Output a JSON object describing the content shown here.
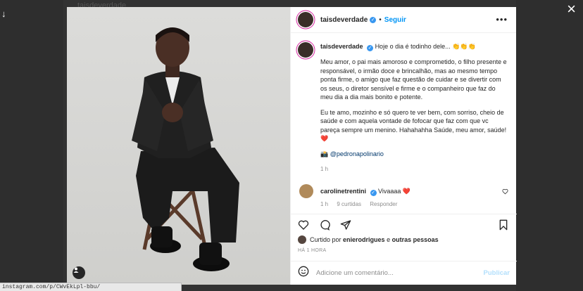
{
  "browser": {
    "ghost_title": "taisdeverdade",
    "status_url": "instagram.com/p/CWvEkLpl-bbu/"
  },
  "post": {
    "username": "taisdeverdade",
    "follow_label": "Seguir",
    "more_label": "•••",
    "caption_intro": "Hoje o dia é todinho dele... 👏👏👏",
    "caption_p1": "Meu amor, o pai mais amoroso e comprometido, o filho presente e responsável, o irmão doce e brincalhão, mas ao mesmo tempo ponta firme, o amigo que faz questão de cuidar e se divertir com os seus, o diretor sensível e firme e o companheiro que faz do meu dia a dia mais bonito e potente.",
    "caption_p2": "Eu te amo, mozinho e só quero te ver bem, com sorriso, cheio de saúde e com aquela vontade de fofocar que faz com que vc pareça sempre um menino. Hahahahha Saúde, meu amor, saúde! ❤️",
    "photo_credit": "📸 @pedronapolinario",
    "caption_time": "1 h",
    "comment": {
      "username": "carolinetrentini",
      "text": "Vivaaaa ❤️",
      "time": "1 h",
      "likes": "9 curtidas",
      "reply": "Responder"
    },
    "liked_prefix": "Curtido por",
    "liked_user": "enierodrigues",
    "liked_mid": "e",
    "liked_others": "outras pessoas",
    "posted_ago": "HÁ 1 HORA",
    "add_comment_placeholder": "Adicione um comentário...",
    "publish_label": "Publicar"
  },
  "colors": {
    "accent": "#0095f6",
    "verified": "#3897f0",
    "heart": "#ed4956",
    "muted": "#8e8e8e"
  },
  "icons": [
    "back-arrow-icon",
    "close-icon",
    "more-icon",
    "verified-icon",
    "heart-icon",
    "comment-icon",
    "share-icon",
    "save-icon",
    "emoji-icon",
    "tag-user-icon"
  ]
}
